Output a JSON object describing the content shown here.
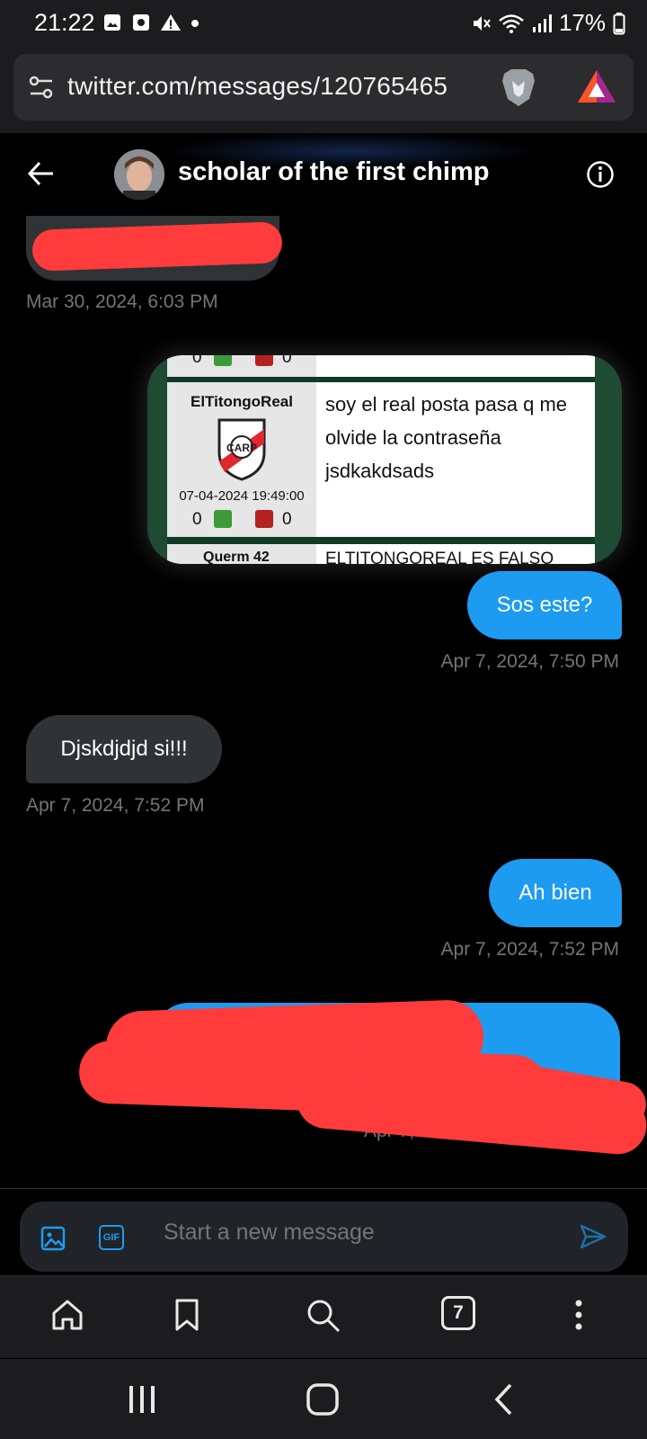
{
  "status_bar": {
    "time": "21:22",
    "battery": "17%"
  },
  "browser": {
    "url": "twitter.com/messages/120765465",
    "tab_count": "7"
  },
  "chat": {
    "contact_name": "scholar of the first chimp"
  },
  "messages": [
    {
      "type": "received",
      "redacted": true,
      "timestamp": "Mar 30, 2024, 6:03 PM"
    },
    {
      "type": "sent-image",
      "forum_post": {
        "username": "ElTitongoReal",
        "date": "07-04-2024 19:49:00",
        "text": "soy el real posta pasa q me olvide la contraseña jsdkakdsads",
        "likes": "0",
        "dislikes": "0",
        "prev_likes": "0",
        "prev_dislikes": "0",
        "next_user_partial": "Querm 42",
        "next_text_partial": "ELTITONGOREAL ES FALSO"
      }
    },
    {
      "type": "sent",
      "text": "Sos este?",
      "timestamp": "Apr 7, 2024, 7:50 PM"
    },
    {
      "type": "received",
      "text": "Djskdjdjd si!!!",
      "timestamp": "Apr 7, 2024, 7:52 PM"
    },
    {
      "type": "sent",
      "text": "Ah bien",
      "timestamp": "Apr 7, 2024, 7:52 PM"
    },
    {
      "type": "sent",
      "redacted": true,
      "timestamp_partial": "Apr 7, 20"
    }
  ],
  "composer": {
    "placeholder": "Start a new message",
    "gif_label": "GIF"
  },
  "colors": {
    "accent": "#1d9bf0",
    "received_bubble": "#2f3336",
    "redaction": "#ff3b3b",
    "timestamp": "#71767b"
  }
}
